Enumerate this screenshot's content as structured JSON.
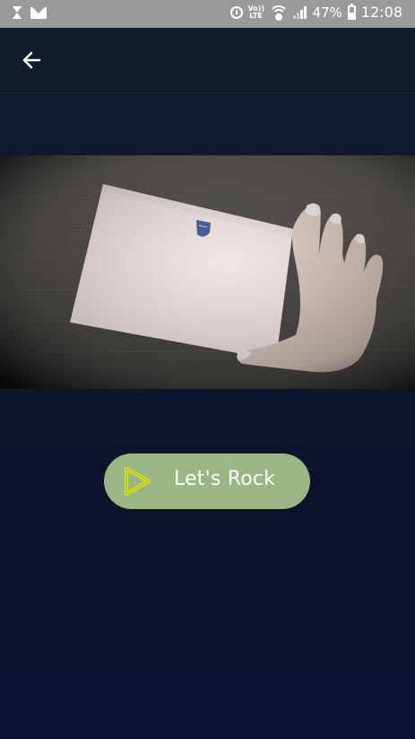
{
  "status_bar": {
    "icons_left": [
      "hourglass-icon",
      "mail-icon"
    ],
    "icons_right": [
      "alarm-icon",
      "volte-icon",
      "wifi-icon",
      "signal-icon"
    ],
    "volte_line1": "Vo))",
    "volte_line2": "LTE",
    "battery_percent": "47%",
    "time": "12:08"
  },
  "header": {
    "back_icon": "arrow-left-icon"
  },
  "video": {
    "thumbnail_description_icon": "crest-icon"
  },
  "cta": {
    "label": "Let's Rock",
    "icon": "play-triangle-icon",
    "background_color": "#9bb685",
    "icon_color": "#d6e21c"
  },
  "colors": {
    "status_bar": "#9a9a9a",
    "app_background": "#10182c",
    "text": "#ffffff"
  }
}
